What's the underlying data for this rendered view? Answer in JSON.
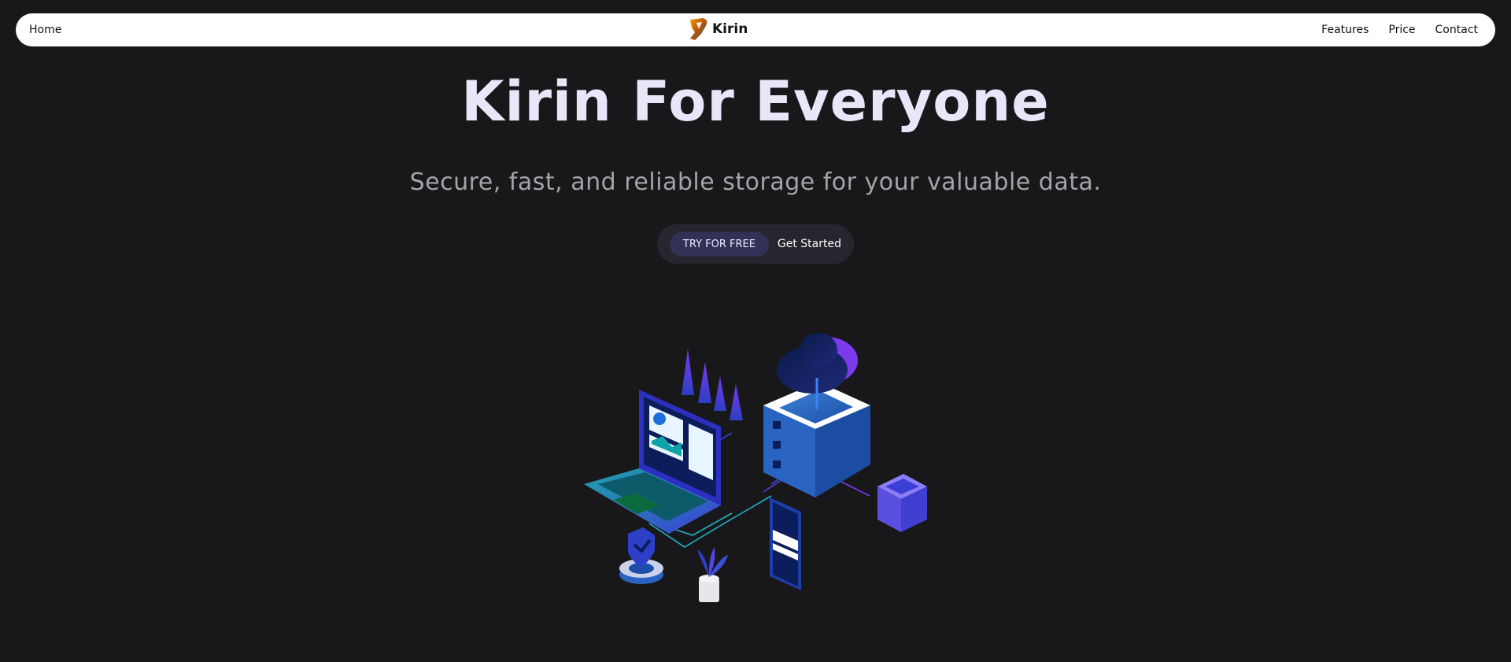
{
  "navbar": {
    "home_label": "Home",
    "brand_name": "Kirin",
    "links": [
      "Features",
      "Price",
      "Contact"
    ]
  },
  "hero": {
    "title": "Kirin For Everyone",
    "subtitle": "Secure, fast, and reliable storage for your valuable data.",
    "cta_primary": "TRY FOR FREE",
    "cta_secondary": "Get Started"
  },
  "colors": {
    "background": "#18181b",
    "navbar": "#ffffff",
    "title": "#e8e6f8",
    "subtitle": "#a3a3a8",
    "cta_group_bg": "#26262f",
    "cta_primary_bg": "#313156"
  }
}
